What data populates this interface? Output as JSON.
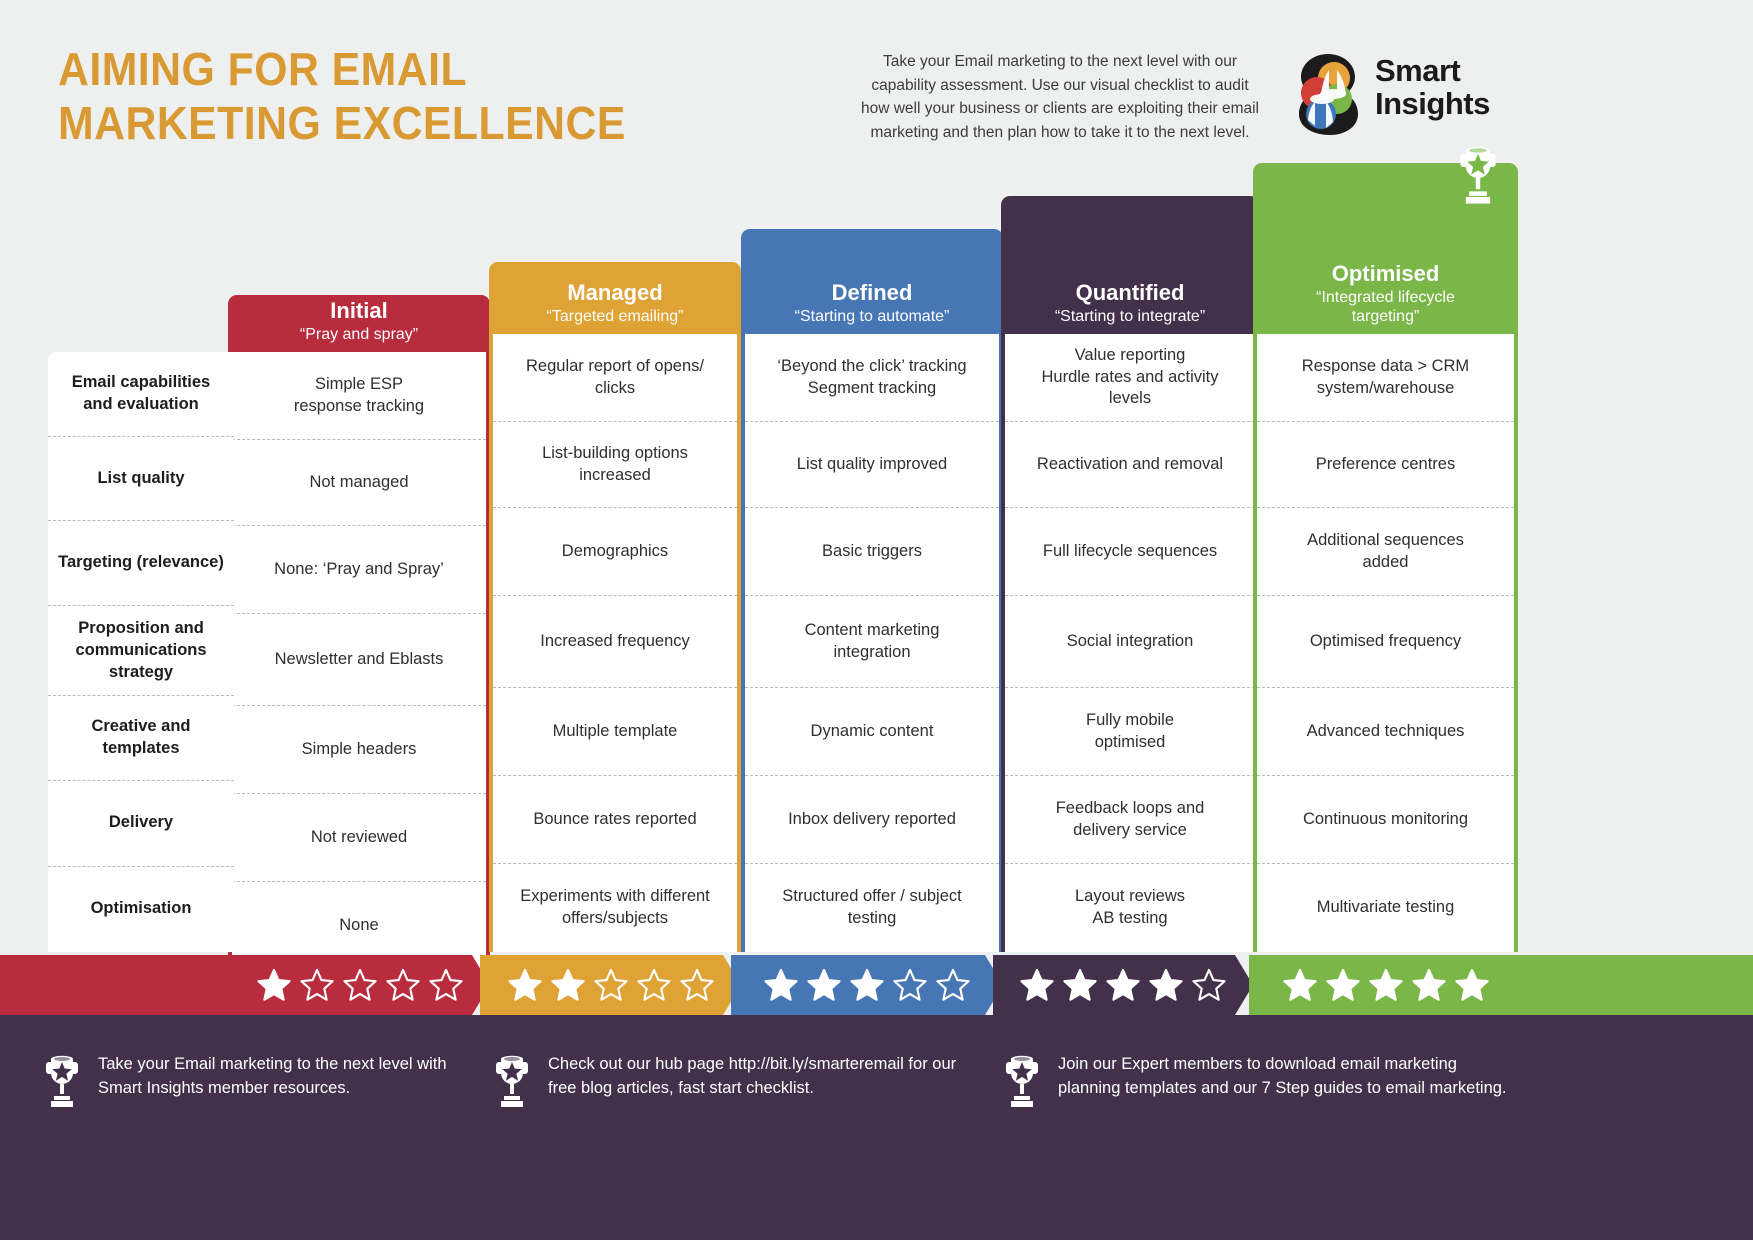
{
  "header": {
    "title_line1": "AIMING FOR EMAIL",
    "title_line2": "MARKETING EXCELLENCE",
    "title_color": "#d99a33",
    "intro": "Take your Email marketing to the next level with our capability assessment. Use our visual checklist to audit how well your business or clients are exploiting their email marketing and then plan how to take it to the next level.",
    "logo_line1": "Smart",
    "logo_line2": "Insights",
    "logo_colors": {
      "orange": "#e8a33d",
      "red": "#cf3f36",
      "green": "#7ab648",
      "blue": "#3f77bd",
      "outline": "#1b1b1b"
    }
  },
  "rows": [
    "Email capabilities and evaluation",
    "List quality",
    "Targeting (relevance)",
    "Proposition and communications strategy",
    "Creative and templates",
    "Delivery",
    "Optimisation"
  ],
  "columns": [
    {
      "name": "Initial",
      "subtitle": "“Pray and spray”",
      "color": "#b92c3e",
      "stars": 1,
      "trophy": false,
      "cells": [
        "Simple ESP\nresponse tracking",
        "Not managed",
        "None: ‘Pray and Spray’",
        "Newsletter and Eblasts",
        "Simple headers",
        "Not reviewed",
        "None"
      ]
    },
    {
      "name": "Managed",
      "subtitle": "“Targeted emailing”",
      "color": "#dfa235",
      "stars": 2,
      "trophy": false,
      "cells": [
        "Regular report of opens/\nclicks",
        "List-building options\nincreased",
        "Demographics",
        "Increased frequency",
        "Multiple template",
        "Bounce rates reported",
        "Experiments with different\noffers/subjects"
      ]
    },
    {
      "name": "Defined",
      "subtitle": "“Starting to automate”",
      "color": "#4677b4",
      "stars": 3,
      "trophy": false,
      "cells": [
        "‘Beyond the click’ tracking\nSegment tracking",
        "List quality improved",
        "Basic triggers",
        "Content marketing\nintegration",
        "Dynamic content",
        "Inbox delivery reported",
        "Structured offer / subject\ntesting"
      ]
    },
    {
      "name": "Quantified",
      "subtitle": "“Starting to integrate”",
      "color": "#43304a",
      "stars": 4,
      "trophy": false,
      "cells": [
        "Value reporting\nHurdle rates and activity\nlevels",
        "Reactivation and removal",
        "Full lifecycle sequences",
        "Social integration",
        "Fully mobile\noptimised",
        "Feedback loops and\ndelivery service",
        "Layout reviews\nAB testing"
      ]
    },
    {
      "name": "Optimised",
      "subtitle": "“Integrated lifecycle\ntargeting”",
      "color": "#7ab648",
      "stars": 5,
      "trophy": true,
      "cells": [
        "Response data > CRM\nsystem/warehouse",
        "Preference centres",
        "Additional sequences\nadded",
        "Optimised frequency",
        "Advanced techniques",
        "Continuous monitoring",
        "Multivariate testing"
      ]
    }
  ],
  "footer": {
    "background": "#43304a",
    "items": [
      "Take your Email marketing to the next level with Smart Insights member resources.",
      "Check out our hub page http://bit.ly/smarteremail for our free blog articles, fast start checklist.",
      "Join our Expert members to download email marketing planning templates and our 7 Step guides to email marketing."
    ]
  }
}
